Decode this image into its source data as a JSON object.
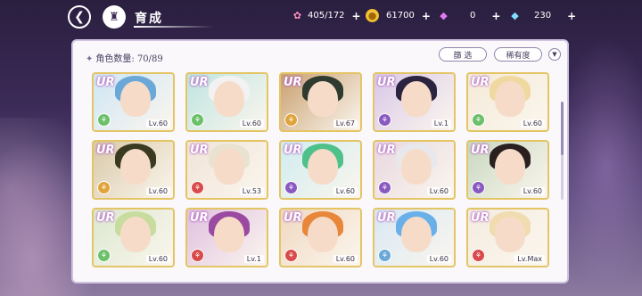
{
  "header": {
    "title": "育成",
    "resources": [
      {
        "icon": "candy-icon",
        "value": "405/172"
      },
      {
        "icon": "coin-icon",
        "value": "61700"
      },
      {
        "icon": "pink-gem-icon",
        "value": "0"
      },
      {
        "icon": "blue-gem-icon",
        "value": "230"
      }
    ]
  },
  "panel": {
    "count_label": "角色数量: 70/89",
    "filter_label": "篩 选",
    "rarity_label": "稀有度"
  },
  "cards": [
    {
      "rarity": "UR",
      "level": "Lv.60",
      "elem_color": "#6cc06a",
      "hair": "#6aa8d8",
      "bg": "#cfe6f5"
    },
    {
      "rarity": "UR",
      "level": "Lv.60",
      "elem_color": "#6cc06a",
      "hair": "#f2f2f2",
      "bg": "#bfe4e0"
    },
    {
      "rarity": "UR",
      "level": "Lv.67",
      "elem_color": "#e0a43a",
      "hair": "#2f3b2f",
      "bg": "#c9a070"
    },
    {
      "rarity": "UR",
      "level": "Lv.1",
      "elem_color": "#8a5ac0",
      "hair": "#2a2440",
      "bg": "#d9c8e8"
    },
    {
      "rarity": "UR",
      "level": "Lv.60",
      "elem_color": "#6cc06a",
      "hair": "#f0d9a0",
      "bg": "#f4ead8"
    },
    {
      "rarity": "UR",
      "level": "Lv.60",
      "elem_color": "#e0a43a",
      "hair": "#3a3a20",
      "bg": "#d8c9a8"
    },
    {
      "rarity": "UR",
      "level": "Lv.53",
      "elem_color": "#d94a4a",
      "hair": "#eae2d0",
      "bg": "#f0e4d8"
    },
    {
      "rarity": "UR",
      "level": "Lv.60",
      "elem_color": "#8a5ac0",
      "hair": "#4ec08a",
      "bg": "#d0ecf0"
    },
    {
      "rarity": "UR",
      "level": "Lv.60",
      "elem_color": "#8a5ac0",
      "hair": "#e8e8ec",
      "bg": "#e8d8e0"
    },
    {
      "rarity": "UR",
      "level": "Lv.60",
      "elem_color": "#8a5ac0",
      "hair": "#2a2020",
      "bg": "#c8d8c0"
    },
    {
      "rarity": "UR",
      "level": "Lv.60",
      "elem_color": "#6cc06a",
      "hair": "#c8dca0",
      "bg": "#dce8d0"
    },
    {
      "rarity": "UR",
      "level": "Lv.1",
      "elem_color": "#d94a4a",
      "hair": "#9a4aa0",
      "bg": "#e0c0e0"
    },
    {
      "rarity": "UR",
      "level": "Lv.60",
      "elem_color": "#d94a4a",
      "hair": "#e8873a",
      "bg": "#f0d8c0"
    },
    {
      "rarity": "UR",
      "level": "Lv.60",
      "elem_color": "#6aa8d8",
      "hair": "#6ab0e8",
      "bg": "#d8e8f4"
    },
    {
      "rarity": "UR",
      "level": "Lv.Max",
      "elem_color": "#d94a4a",
      "hair": "#f0dcb0",
      "bg": "#f4ece0"
    }
  ]
}
